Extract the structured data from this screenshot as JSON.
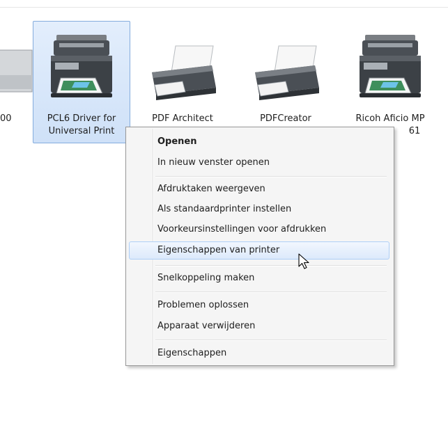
{
  "devices": [
    {
      "label_line1": "00",
      "label_line2": ""
    },
    {
      "label_line1": "PCL6 Driver for",
      "label_line2": "Universal Print"
    },
    {
      "label_line1": "PDF Architect",
      "label_line2": ""
    },
    {
      "label_line1": "PDFCreator",
      "label_line2": ""
    },
    {
      "label_line1": "Ricoh Aficio MP",
      "label_line2": "61"
    }
  ],
  "context_menu": {
    "items": [
      {
        "label": "Openen"
      },
      {
        "label": "In nieuw venster openen"
      },
      {
        "label": "Afdruktaken weergeven"
      },
      {
        "label": "Als standaardprinter instellen"
      },
      {
        "label": "Voorkeursinstellingen voor afdrukken"
      },
      {
        "label": "Eigenschappen van printer"
      },
      {
        "label": "Snelkoppeling maken"
      },
      {
        "label": "Problemen oplossen"
      },
      {
        "label": "Apparaat verwijderen"
      },
      {
        "label": "Eigenschappen"
      }
    ]
  },
  "colors": {
    "selection_border": "#84acdd",
    "menu_background": "#f5f5f5",
    "menu_hover_border": "#aecff7"
  },
  "icons": {
    "mfp_printer": "multifunction-printer-icon",
    "printer": "printer-icon",
    "cursor": "mouse-cursor-icon"
  }
}
